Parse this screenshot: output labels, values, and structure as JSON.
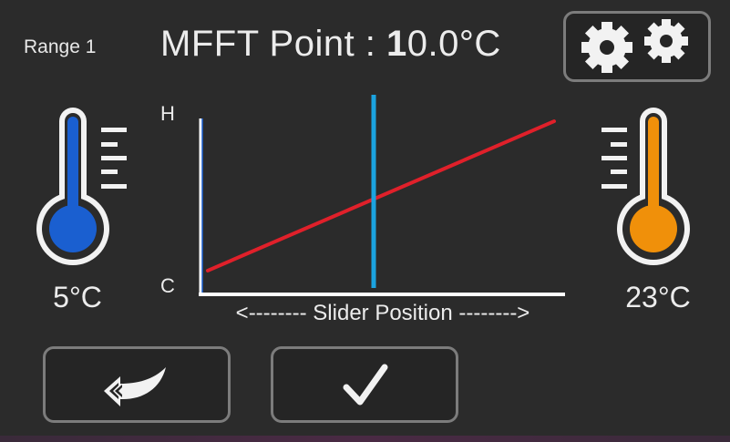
{
  "header": {
    "range_label": "Range 1",
    "title_prefix": "MFFT Point : ",
    "title_value_first": "1",
    "title_value_rest": "0.0°C"
  },
  "settings": {
    "icon": "gears-icon"
  },
  "chart_data": {
    "type": "line",
    "xlabel": "<-------- Slider Position -------->",
    "ylabel_top": "H",
    "ylabel_bottom": "C",
    "x": [
      0,
      100
    ],
    "series": [
      {
        "values": [
          5,
          23
        ],
        "color": "#e0202a"
      }
    ],
    "marker_x": 50,
    "marker_color": "#1ba3e0",
    "xlim": [
      0,
      100
    ],
    "ylim": [
      4,
      24
    ],
    "grid": false
  },
  "cold": {
    "temp": "5°C",
    "color": "#1a5fd0",
    "icon": "thermometer-cold-icon"
  },
  "hot": {
    "temp": "23°C",
    "color": "#f0900a",
    "icon": "thermometer-hot-icon"
  },
  "buttons": {
    "back_icon": "back-arrow-icon",
    "accept_icon": "checkmark-icon"
  },
  "colors": {
    "background": "#2b2b2b",
    "button_border": "#7c7c7c",
    "text": "#ececec"
  }
}
